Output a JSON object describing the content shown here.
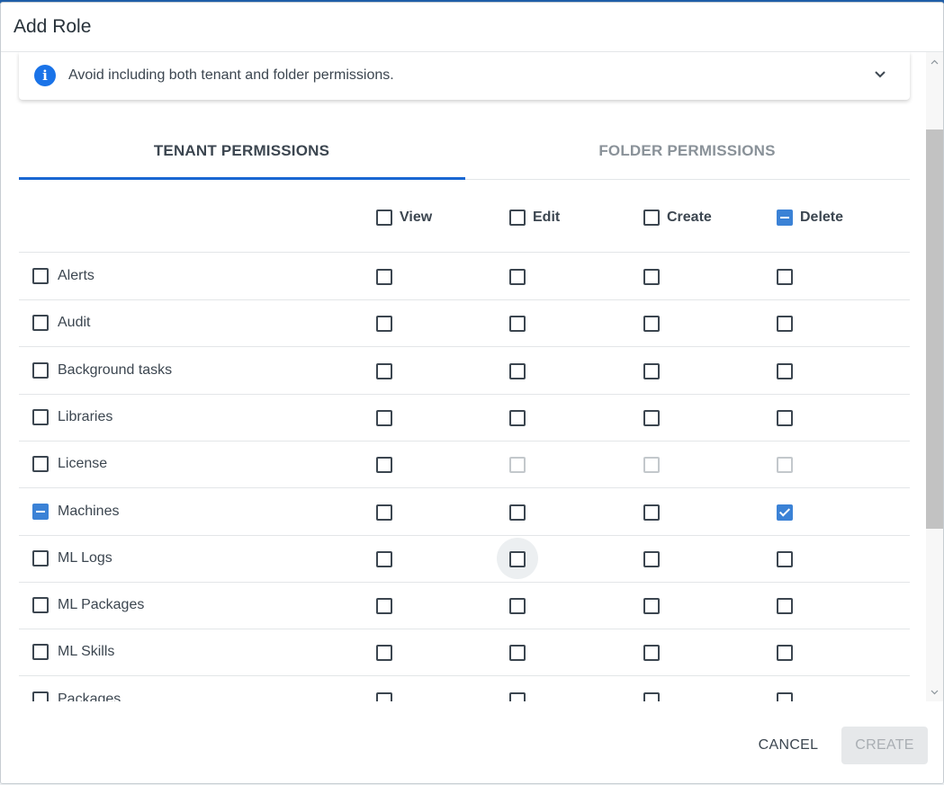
{
  "dialog": {
    "title": "Add Role"
  },
  "banner": {
    "icon": "info-icon",
    "text": "Avoid including both tenant and folder permissions."
  },
  "tabs": [
    {
      "label": "TENANT PERMISSIONS",
      "active": true
    },
    {
      "label": "FOLDER PERMISSIONS",
      "active": false
    }
  ],
  "columns": [
    {
      "label": "View",
      "state": "unchecked"
    },
    {
      "label": "Edit",
      "state": "unchecked"
    },
    {
      "label": "Create",
      "state": "unchecked"
    },
    {
      "label": "Delete",
      "state": "indeterminate"
    }
  ],
  "rows": [
    {
      "name": "Alerts",
      "state": "unchecked",
      "view": "unchecked",
      "edit": "unchecked",
      "create": "unchecked",
      "delete": "unchecked"
    },
    {
      "name": "Audit",
      "state": "unchecked",
      "view": "unchecked",
      "edit": "unchecked",
      "create": "unchecked",
      "delete": "unchecked"
    },
    {
      "name": "Background tasks",
      "state": "unchecked",
      "view": "unchecked",
      "edit": "unchecked",
      "create": "unchecked",
      "delete": "unchecked"
    },
    {
      "name": "Libraries",
      "state": "unchecked",
      "view": "unchecked",
      "edit": "unchecked",
      "create": "unchecked",
      "delete": "unchecked"
    },
    {
      "name": "License",
      "state": "unchecked",
      "view": "unchecked",
      "edit": "disabled",
      "create": "disabled",
      "delete": "disabled"
    },
    {
      "name": "Machines",
      "state": "indeterminate",
      "view": "unchecked",
      "edit": "unchecked",
      "create": "unchecked",
      "delete": "checked"
    },
    {
      "name": "ML Logs",
      "state": "unchecked",
      "view": "unchecked",
      "edit": "unchecked",
      "create": "unchecked",
      "delete": "unchecked"
    },
    {
      "name": "ML Packages",
      "state": "unchecked",
      "view": "unchecked",
      "edit": "unchecked",
      "create": "unchecked",
      "delete": "unchecked"
    },
    {
      "name": "ML Skills",
      "state": "unchecked",
      "view": "unchecked",
      "edit": "unchecked",
      "create": "unchecked",
      "delete": "unchecked"
    },
    {
      "name": "Packages",
      "state": "unchecked",
      "view": "unchecked",
      "edit": "unchecked",
      "create": "unchecked",
      "delete": "unchecked"
    }
  ],
  "footer": {
    "cancel_label": "CANCEL",
    "create_label": "CREATE",
    "create_enabled": false
  },
  "colors": {
    "accent": "#1967d2",
    "checkbox_checked": "#3b82d6",
    "info_icon": "#1a73e8"
  }
}
